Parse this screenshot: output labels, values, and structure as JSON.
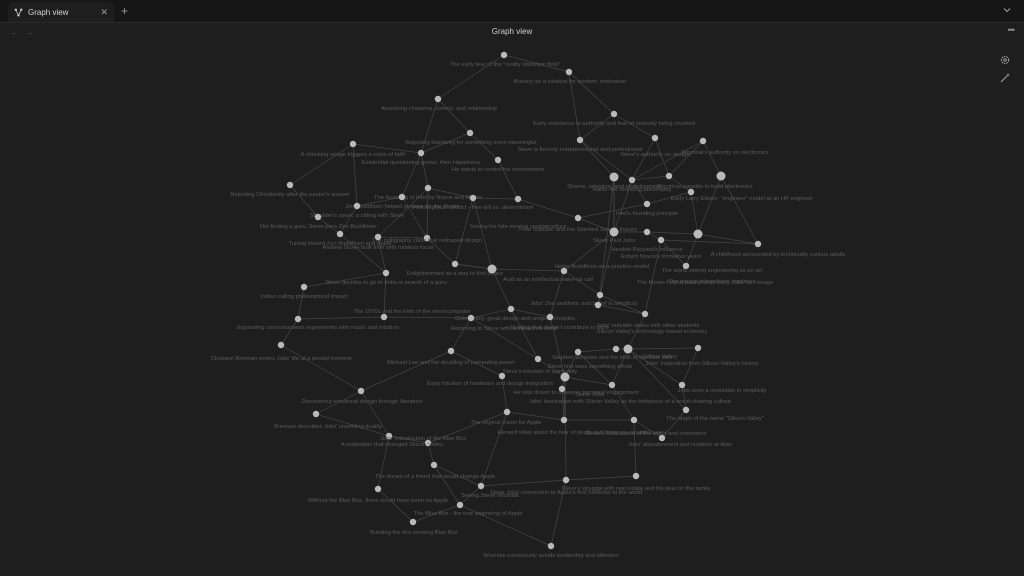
{
  "tab": {
    "title": "Graph view",
    "icon": "graph-icon",
    "close_icon": "close-icon"
  },
  "tabbar": {
    "new_tab_icon": "plus-icon",
    "menu_icon": "chevron-down-icon"
  },
  "nav": {
    "back_icon": "arrow-left-icon",
    "forward_icon": "arrow-right-icon"
  },
  "header": {
    "title": "Graph view",
    "more_icon": "more-horizontal-icon"
  },
  "controls": {
    "settings_icon": "gear-icon",
    "animate_icon": "magic-wand-icon"
  },
  "colors": {
    "background": "#1e1e1e",
    "node": "#b9b9b9",
    "edge": "#454545",
    "label": "#5a5a5a"
  },
  "graph": {
    "nodes": [
      {
        "id": "n1",
        "label": "The early fear of the \"reality distortion field\""
      },
      {
        "id": "n2",
        "label": "Bravery as a catalyst for wisdom, motivation"
      },
      {
        "id": "n3",
        "label": "Absorbing charisma, control, and relationship"
      },
      {
        "id": "n4",
        "label": "Early resistance to authority and fear of curiosity being crushed"
      },
      {
        "id": "n5",
        "label": "Rejecting Ramborg for something more meaningful"
      },
      {
        "id": "n6",
        "label": "A shocking image triggers a crisis of faith"
      },
      {
        "id": "n7",
        "label": "Existential questioning grows, then Happiness"
      },
      {
        "id": "n8",
        "label": "He wants to control his environment"
      },
      {
        "id": "n9",
        "label": "Rejecting Christianity after the pastor's answer"
      },
      {
        "id": "n10",
        "label": "The founding of Intel by Noyce and Moore"
      },
      {
        "id": "n11",
        "label": "Steve is fiercely entrepreneurial and perfectionist"
      },
      {
        "id": "n12",
        "label": "Zen Buddhism helped prepare for the Stride"
      },
      {
        "id": "n13",
        "label": "Shoulder's spark: a sitting with Steve"
      },
      {
        "id": "n14",
        "label": "Not finding a guru, Steve joins Zen Buddhism"
      },
      {
        "id": "n15",
        "label": "Tuning toward Zen Buddhism and Apple"
      },
      {
        "id": "n16",
        "label": "Philosophical conflict - free will vs. determinism"
      },
      {
        "id": "n17",
        "label": "The calligraphy class that reshaped design"
      },
      {
        "id": "n18",
        "label": "Seeing his fate moving counterculture"
      },
      {
        "id": "n19",
        "label": "Andrew Grove built Intel with ruthless focus"
      },
      {
        "id": "n20",
        "label": "Enlightenment as a way to find peace"
      },
      {
        "id": "n21",
        "label": "Steve decides to go to India in search of a guru"
      },
      {
        "id": "n22",
        "label": "Indian calling philosophical impact"
      },
      {
        "id": "n23",
        "label": "Pete Sobutec and the Stanford Sexual Inquiry"
      },
      {
        "id": "n24",
        "label": "Steve Paul Jobs"
      },
      {
        "id": "n25",
        "label": "Hewlett-Packard's influence"
      },
      {
        "id": "n26",
        "label": "Robert Noyce's formative years"
      },
      {
        "id": "n27",
        "label": "Intel's founding principle"
      },
      {
        "id": "n28",
        "label": "Haiku-like founding philosophy"
      },
      {
        "id": "n29",
        "label": "Wozniak's authority on electronics"
      },
      {
        "id": "n30",
        "label": "Steve's authority on design"
      },
      {
        "id": "n31",
        "label": "Shame, adoption, and abandonment"
      },
      {
        "id": "n32",
        "label": "Early Larry Ellison: \"engineer\" model at an HP engineer"
      },
      {
        "id": "n33",
        "label": "A childhood surrounded by technically curious adults"
      },
      {
        "id": "n34",
        "label": "Electrical appetite to build electronics"
      },
      {
        "id": "n35",
        "label": "The garage microphone mystery"
      },
      {
        "id": "n36",
        "label": "The world seeing engineering as an art"
      },
      {
        "id": "n37",
        "label": "Helps Buddhism as a practice model"
      },
      {
        "id": "n38",
        "label": "The Moore-Noyce partnership: early Jobs' self-image"
      },
      {
        "id": "n39",
        "label": "Jobs' Zen aesthetic and belief in simplicity"
      },
      {
        "id": "n40",
        "label": "The 1970s and the birth of the microcomputer"
      },
      {
        "id": "n41",
        "label": "Acid as an intellectual wake-up call"
      },
      {
        "id": "n42",
        "label": "Going early, great design and simple principles"
      },
      {
        "id": "n43",
        "label": "Expanding consciousness experiments with music and intuition"
      },
      {
        "id": "n44",
        "label": "Returning to Steve with a mission in mind"
      },
      {
        "id": "n45",
        "label": "Nothing that doesn't contribute to style"
      },
      {
        "id": "n46",
        "label": "Jobs' outsider status with other students"
      },
      {
        "id": "n47",
        "label": "Silicon Valley's technology-based economy"
      },
      {
        "id": "n48",
        "label": "Chrisann Brennan enters Jobs' life at a pivotal moment"
      },
      {
        "id": "n49",
        "label": "Stephen Wozniak and the birth of the Blue Box"
      },
      {
        "id": "n50",
        "label": "Michael Lee and the doubling of computing power"
      },
      {
        "id": "n51",
        "label": "Steve's mindset of spirituality"
      },
      {
        "id": "n52",
        "label": "Jobs' inspiration from Silicon Valley's history"
      },
      {
        "id": "n53",
        "label": "Steve first sees something whole"
      },
      {
        "id": "n54",
        "label": "Early intuition of hardware and design integration"
      },
      {
        "id": "n55",
        "label": "Steve Jobs"
      },
      {
        "id": "n56",
        "label": "He was drawn to a deeper personal engagement"
      },
      {
        "id": "n57",
        "label": "Silicon Valley"
      },
      {
        "id": "n58",
        "label": "Jobs sees a revolution in simplicity"
      },
      {
        "id": "n59",
        "label": "Jobs' fascination with Silicon Valley as the birthplace of a world-shaking culture"
      },
      {
        "id": "n60",
        "label": "Discovering emotional design through literature"
      },
      {
        "id": "n61",
        "label": "The origin of the name \"Silicon Valley\""
      },
      {
        "id": "n62",
        "label": "The original vision for Apple"
      },
      {
        "id": "n63",
        "label": "Brennan describes Jobs' unsettling duality"
      },
      {
        "id": "n64",
        "label": "Herwell rebel about the fear of death and limits you wouldn't see"
      },
      {
        "id": "n65",
        "label": "Steve's idealization of the world and commerce"
      },
      {
        "id": "n66",
        "label": "Jobs' Introduction of the Blue Box"
      },
      {
        "id": "n67",
        "label": "A realisation that changed Silicon Valley"
      },
      {
        "id": "n68",
        "label": "Jobs' abandonment and isolation at Atari"
      },
      {
        "id": "n69",
        "label": "The dream of a friend that would change Apple"
      },
      {
        "id": "n70",
        "label": "Steve's struggle with real estate and his deal on the family"
      },
      {
        "id": "n71",
        "label": "Without the Blue Box, there would have been no Apple"
      },
      {
        "id": "n72",
        "label": "Seeing Steve Wozniak"
      },
      {
        "id": "n73",
        "label": "Steve Jobs' connection to Apple's first hardship to the world"
      },
      {
        "id": "n74",
        "label": "The Blue Box - the true beginning of Apple"
      },
      {
        "id": "n75",
        "label": "Building the first working Blue Box"
      },
      {
        "id": "n76",
        "label": "Wozniak consciously avoids leadership and attention"
      }
    ]
  }
}
